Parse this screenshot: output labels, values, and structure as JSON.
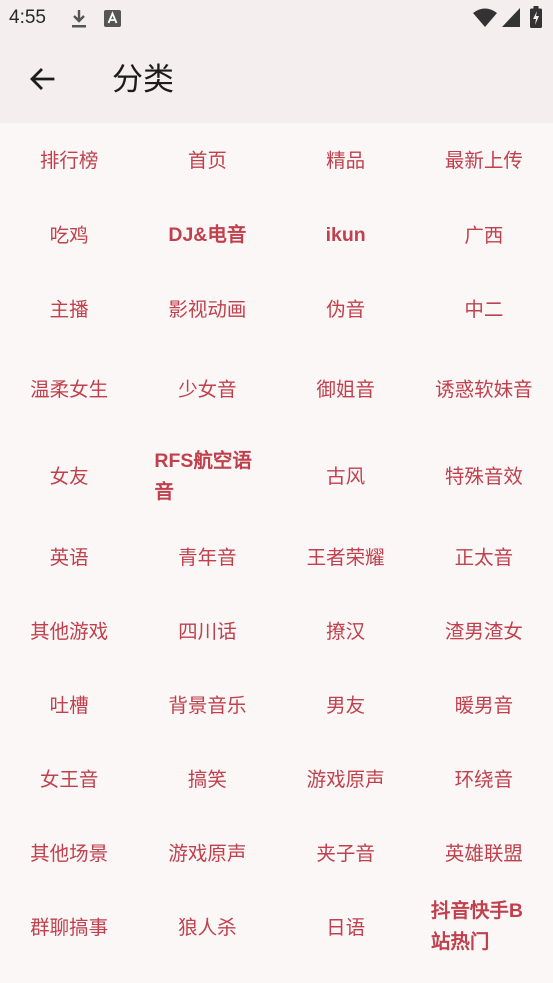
{
  "status_bar": {
    "time": "4:55",
    "icons": [
      "download-icon",
      "a-badge-icon",
      "wifi-icon",
      "cellular-signal-icon",
      "battery-charging-icon"
    ]
  },
  "app_bar": {
    "back_icon": "arrow-left-icon",
    "title": "分类"
  },
  "categories": [
    [
      "排行榜",
      "首页",
      "精品",
      "最新上传"
    ],
    [
      "吃鸡",
      "DJ&电音",
      "ikun",
      "广西"
    ],
    [
      "主播",
      "影视动画",
      "伪音",
      "中二"
    ],
    [
      "温柔女生",
      "少女音",
      "御姐音",
      "诱惑软妹音"
    ],
    [
      "女友",
      "RFS航空语音",
      "古风",
      "特殊音效"
    ],
    [
      "英语",
      "青年音",
      "王者荣耀",
      "正太音"
    ],
    [
      "其他游戏",
      "四川话",
      "撩汉",
      "渣男渣女"
    ],
    [
      "吐槽",
      "背景音乐",
      "男友",
      "暖男音"
    ],
    [
      "女王音",
      "搞笑",
      "游戏原声",
      "环绕音"
    ],
    [
      "其他场景",
      "游戏原声",
      "夹子音",
      "英雄联盟"
    ],
    [
      "群聊搞事",
      "狼人杀",
      "日语",
      "抖音快手B站热门"
    ]
  ],
  "colors": {
    "accent_text": "#c0414d",
    "bar_background": "#f5eeee",
    "page_background": "#fcf7f7"
  }
}
